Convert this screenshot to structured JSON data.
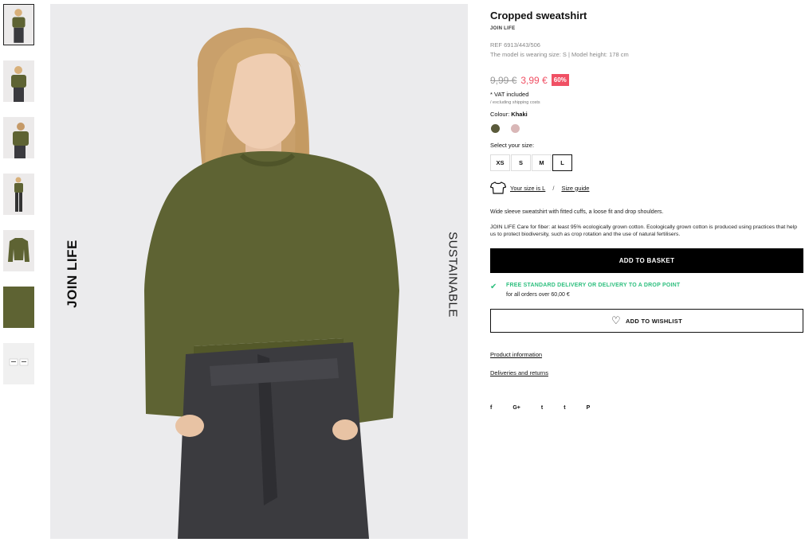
{
  "product": {
    "title": "Cropped sweatshirt",
    "brand": "JOIN LIFE",
    "ref": "REF 6913/443/506",
    "model_info": "The model is wearing size: S | Model height: 178 cm",
    "old_price": "9,99 €",
    "new_price": "3,99 €",
    "discount": "60%",
    "vat": "* VAT included",
    "shipping": "/ excluding shipping costs",
    "colour_label": "Colour:",
    "colour_value": "Khaki",
    "select_size_label": "Select your size:",
    "sizes": [
      "XS",
      "S",
      "M",
      "L"
    ],
    "selected_size": "L",
    "your_size": "Your size is L",
    "size_guide": "Size guide",
    "description": "Wide sleeve sweatshirt with fitted cuffs, a loose fit and drop shoulders.",
    "care": "JOIN LIFE Care for fiber: at least 95% ecologically grown cotton. Ecologically grown cotton is produced using practices that help us to protect biodiversity, such as crop rotation and the use of natural fertilisers.",
    "add_to_basket": "ADD TO BASKET",
    "delivery_title": "FREE STANDARD DELIVERY OR DELIVERY TO A DROP POINT",
    "delivery_sub": "for all orders over 60,00 €",
    "add_to_wishlist": "ADD TO WISHLIST",
    "product_information": "Product information",
    "deliveries_returns": "Deliveries and returns"
  },
  "swatches": [
    {
      "name": "khaki",
      "color": "#5a5a3a"
    },
    {
      "name": "pink",
      "color": "#d9b7b7"
    }
  ],
  "hero": {
    "left_text": "JOIN LIFE",
    "right_text": "SUSTAINABLE"
  },
  "social": [
    {
      "icon": "facebook-icon",
      "glyph": "f"
    },
    {
      "icon": "google-plus-icon",
      "glyph": "G+"
    },
    {
      "icon": "twitter-icon",
      "glyph": "t"
    },
    {
      "icon": "tumblr-icon",
      "glyph": "t"
    },
    {
      "icon": "pinterest-icon",
      "glyph": "P"
    }
  ],
  "colors": {
    "accent": "#f05064",
    "success": "#2dbf7e",
    "khaki": "#5e6333"
  }
}
